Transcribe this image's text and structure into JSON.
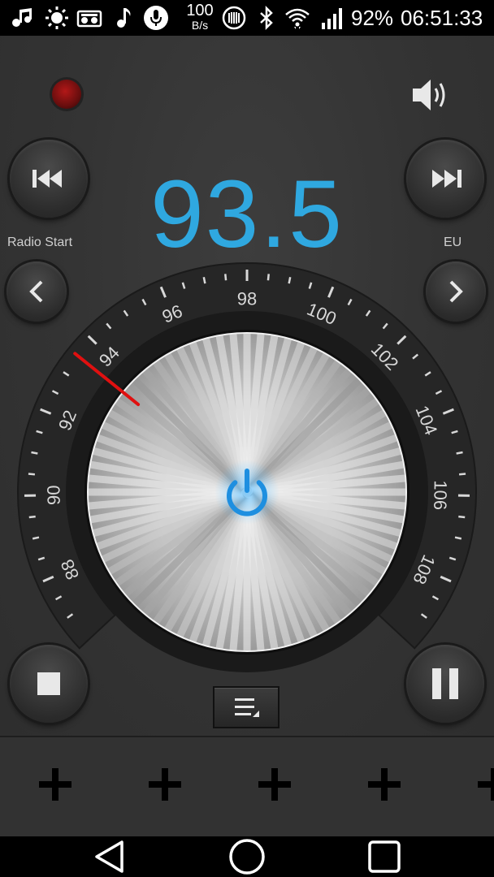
{
  "status_bar": {
    "icons": [
      "music-notes-icon",
      "brightness-icon",
      "radio-icon",
      "music-note-icon",
      "microphone-icon",
      "nfc-icon",
      "bluetooth-icon",
      "wifi-icon",
      "signal-icon"
    ],
    "speed_value": "100",
    "speed_unit": "B/s",
    "battery": "92%",
    "time": "06:51:33"
  },
  "radio": {
    "frequency": "93.5",
    "frequency_color": "#2fa8e0",
    "left_label": "Radio Start",
    "right_label": "EU",
    "record_indicator_color": "#8a1212",
    "power_icon_color": "#1e8fe0"
  },
  "dial": {
    "min": 87,
    "max": 109,
    "current": 93.5,
    "needle_color": "#e01010",
    "labels": [
      {
        "value": 88,
        "text": "88"
      },
      {
        "value": 90,
        "text": "90"
      },
      {
        "value": 92,
        "text": "92"
      },
      {
        "value": 94,
        "text": "94"
      },
      {
        "value": 96,
        "text": "96"
      },
      {
        "value": 98,
        "text": "98"
      },
      {
        "value": 100,
        "text": "100"
      },
      {
        "value": 102,
        "text": "102"
      },
      {
        "value": 104,
        "text": "104"
      },
      {
        "value": 106,
        "text": "106"
      },
      {
        "value": 108,
        "text": "108"
      }
    ]
  },
  "controls": {
    "prev": "skip-previous-icon",
    "next": "skip-next-icon",
    "seek_down": "chevron-left-icon",
    "seek_up": "chevron-right-icon",
    "stop": "stop-icon",
    "pause": "pause-icon",
    "list": "list-menu-icon",
    "volume": "volume-icon",
    "power": "power-icon"
  },
  "presets": [
    {
      "icon": "plus-icon"
    },
    {
      "icon": "plus-icon"
    },
    {
      "icon": "plus-icon"
    },
    {
      "icon": "plus-icon"
    },
    {
      "icon": "plus-icon"
    }
  ],
  "navbar": {
    "back": "back-triangle-icon",
    "home": "home-circle-icon",
    "recents": "recents-square-icon"
  }
}
